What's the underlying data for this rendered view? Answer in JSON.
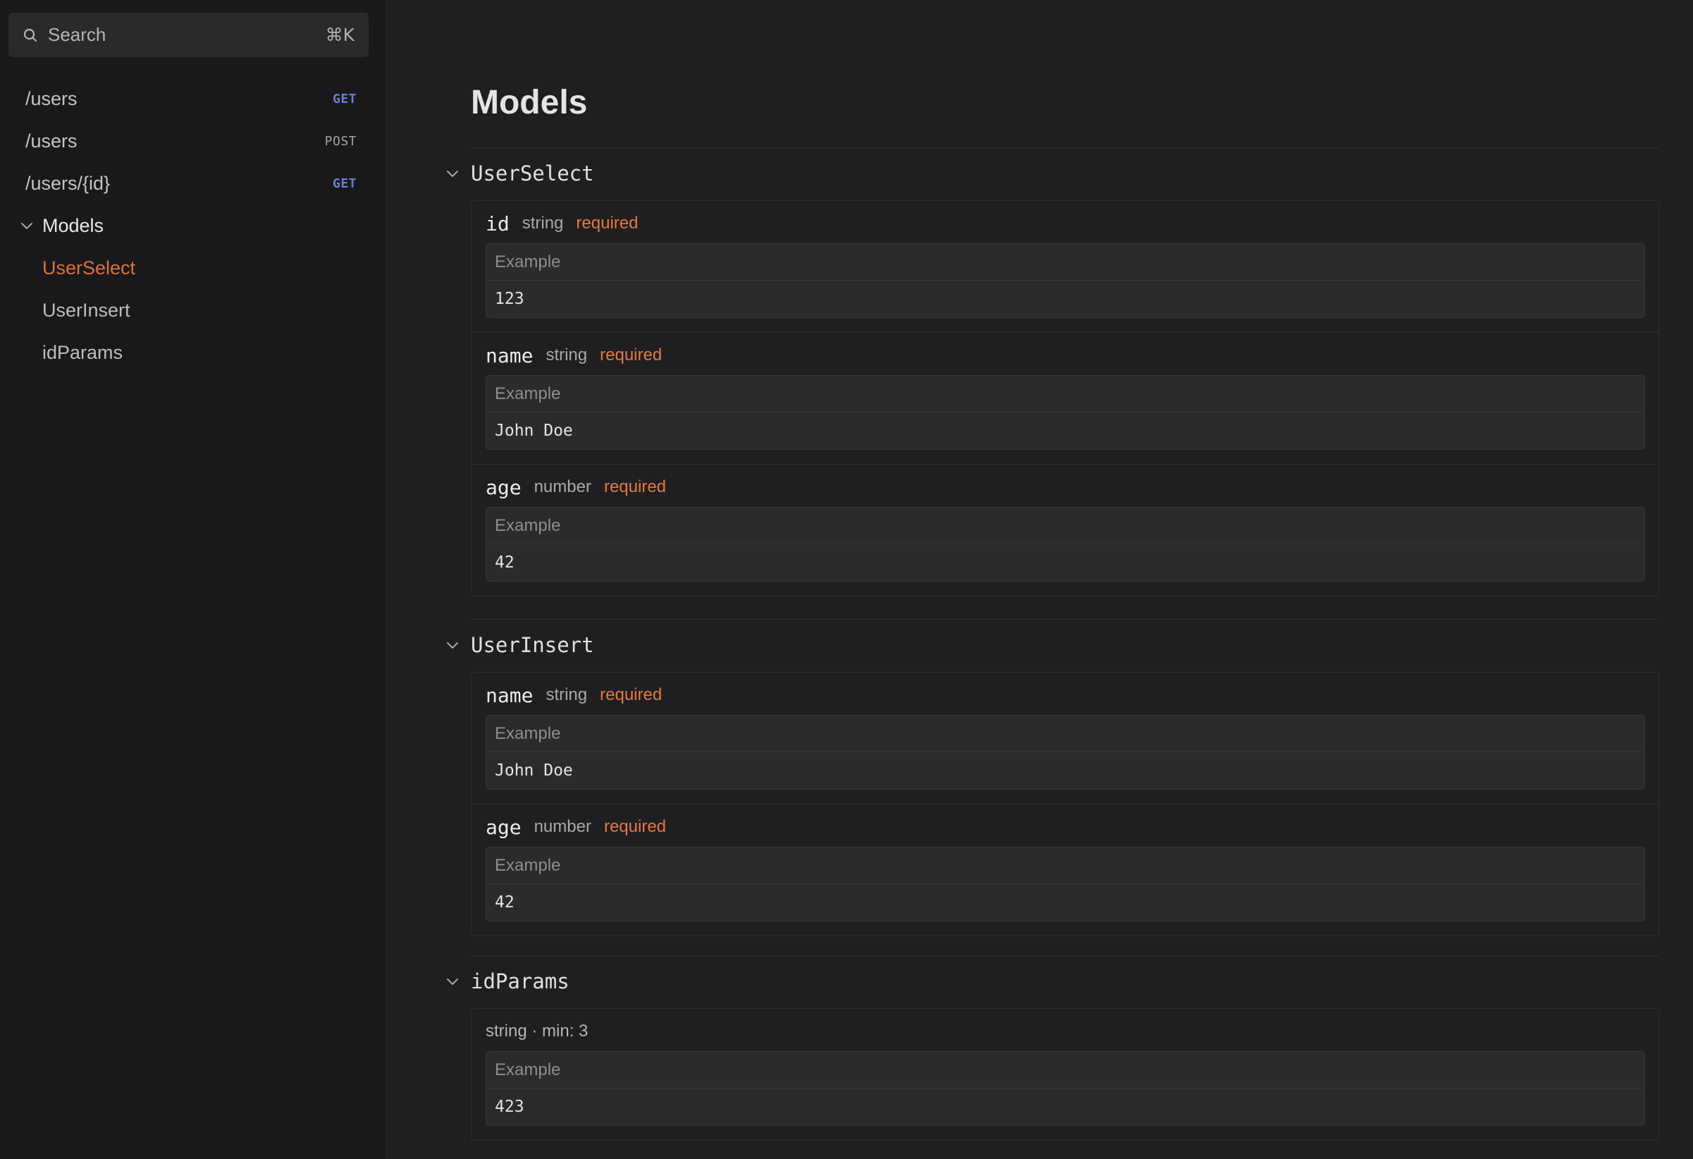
{
  "search": {
    "label": "Search",
    "shortcut": "⌘K",
    "icon": "search-icon"
  },
  "sidebar": {
    "routes": [
      {
        "path": "/users",
        "method": "GET"
      },
      {
        "path": "/users",
        "method": "POST"
      },
      {
        "path": "/users/{id}",
        "method": "GET"
      }
    ],
    "group": {
      "label": "Models",
      "expanded": true
    },
    "models": [
      {
        "label": "UserSelect",
        "active": true
      },
      {
        "label": "UserInsert",
        "active": false
      },
      {
        "label": "idParams",
        "active": false
      }
    ]
  },
  "main": {
    "title": "Models",
    "example_label": "Example",
    "models": [
      {
        "name": "UserSelect",
        "fields": [
          {
            "name": "id",
            "type": "string",
            "required": "required",
            "example": "123"
          },
          {
            "name": "name",
            "type": "string",
            "required": "required",
            "example": "John Doe"
          },
          {
            "name": "age",
            "type": "number",
            "required": "required",
            "example": "42"
          }
        ]
      },
      {
        "name": "UserInsert",
        "fields": [
          {
            "name": "name",
            "type": "string",
            "required": "required",
            "example": "John Doe"
          },
          {
            "name": "age",
            "type": "number",
            "required": "required",
            "example": "42"
          }
        ]
      },
      {
        "name": "idParams",
        "description": "string · min: 3",
        "example": "423"
      }
    ]
  },
  "colors": {
    "accent": "#e0703a",
    "required": "#e8773e",
    "get": "#6a7fd6",
    "background": "#1f1f21",
    "sidebar": "#19191b"
  }
}
